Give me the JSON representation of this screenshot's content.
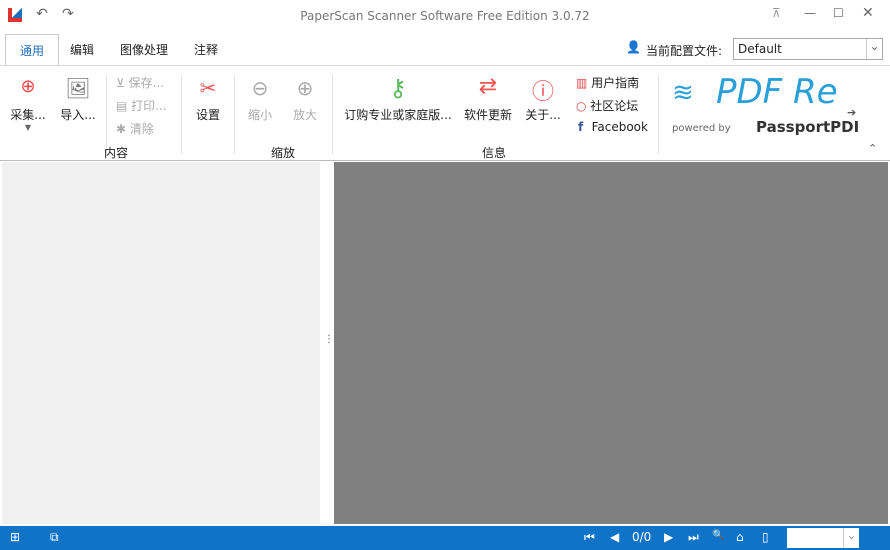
{
  "window": {
    "title": "PaperScan Scanner Software Free Edition 3.0.72"
  },
  "tabs": [
    "通用",
    "编辑",
    "图像处理",
    "注释"
  ],
  "profile": {
    "label": "当前配置文件:",
    "value": "Default"
  },
  "content_group": {
    "label": "内容",
    "acquire": "采集...",
    "import": "导入...",
    "save": "保存...",
    "print": "打印...",
    "clear": "清除",
    "settings": "设置"
  },
  "zoom_group": {
    "label": "缩放",
    "zoom_out": "缩小",
    "zoom_in": "放大"
  },
  "info_group": {
    "label": "信息",
    "buy": "订购专业或家庭版...",
    "update": "软件更新",
    "about": "关于...",
    "guide": "用户指南",
    "forum": "社区论坛",
    "facebook": "Facebook"
  },
  "ad": {
    "title": "PDF Re",
    "powered": "powered by",
    "brand": "PassportPDI"
  },
  "status": {
    "page": "0/0"
  },
  "colors": {
    "accent": "#0f73c7",
    "canvas": "#808080"
  }
}
